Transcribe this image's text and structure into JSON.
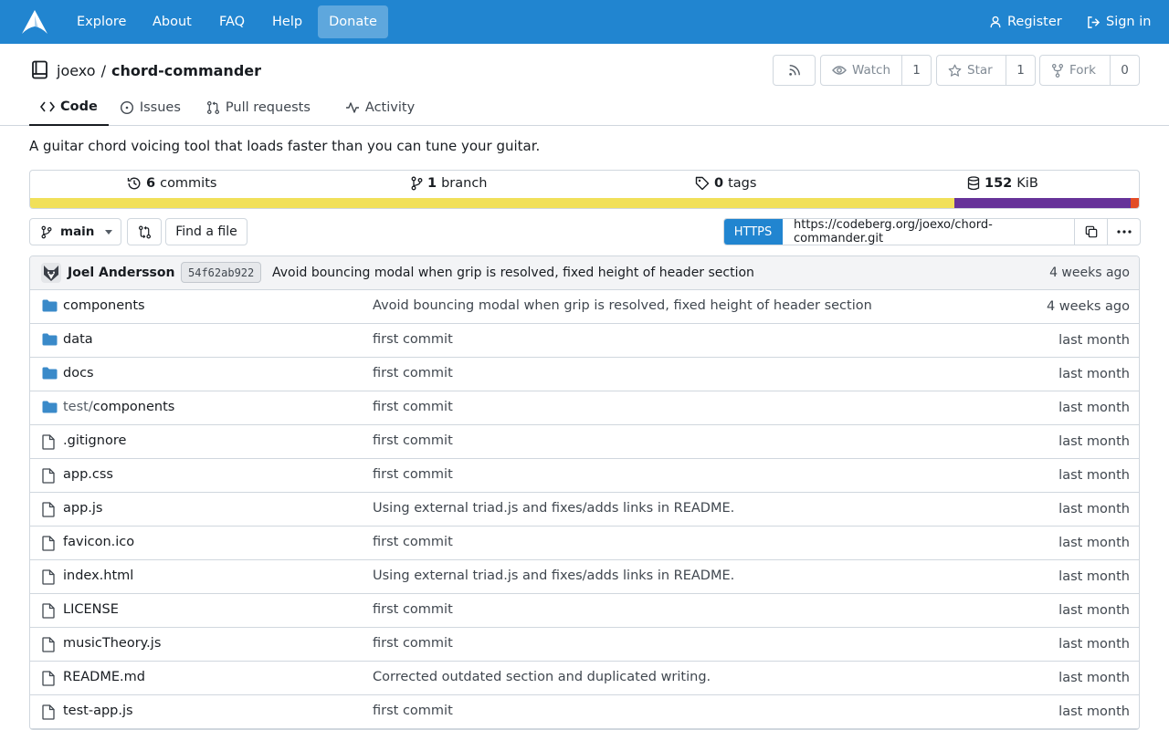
{
  "nav": {
    "items": [
      "Explore",
      "About",
      "FAQ",
      "Help"
    ],
    "donate": "Donate",
    "register": "Register",
    "sign_in": "Sign in",
    "color": "#2185d0"
  },
  "repo": {
    "owner": "joexo",
    "separator": "/",
    "name": "chord-commander",
    "watch_label": "Watch",
    "watch_count": "1",
    "star_label": "Star",
    "star_count": "1",
    "fork_label": "Fork",
    "fork_count": "0"
  },
  "tabs": [
    {
      "label": "Code",
      "icon": "code-icon",
      "active": true
    },
    {
      "label": "Issues",
      "icon": "issue-icon"
    },
    {
      "label": "Pull requests",
      "icon": "pull-request-icon"
    },
    {
      "label": "Activity",
      "icon": "pulse-icon"
    }
  ],
  "description": "A guitar chord voicing tool that loads faster than you can tune your guitar.",
  "stats": {
    "commits_num": "6",
    "commits_label": "commits",
    "branches_num": "1",
    "branches_label": "branch",
    "tags_num": "0",
    "tags_label": "tags",
    "size_num": "152",
    "size_label": "KiB"
  },
  "languages": [
    {
      "color": "#f1e05a",
      "percent": 83.4
    },
    {
      "color": "#663399",
      "percent": 15.9
    },
    {
      "color": "#e34c26",
      "percent": 0.7
    }
  ],
  "toolbar": {
    "branch": "main",
    "find_file": "Find a file",
    "protocol": "HTTPS",
    "clone_url": "https://codeberg.org/joexo/chord-commander.git"
  },
  "latest_commit": {
    "author": "Joel Andersson",
    "sha": "54f62ab922",
    "message": "Avoid bouncing modal when grip is resolved, fixed height of header section",
    "time": "4 weeks ago"
  },
  "files": [
    {
      "type": "folder",
      "name": "components",
      "message": "Avoid bouncing modal when grip is resolved, fixed height of header section",
      "time": "4 weeks ago"
    },
    {
      "type": "folder",
      "name": "data",
      "message": "first commit",
      "time": "last month"
    },
    {
      "type": "folder",
      "name": "docs",
      "message": "first commit",
      "time": "last month"
    },
    {
      "type": "folder",
      "name_prefix": "test/",
      "name": "components",
      "message": "first commit",
      "time": "last month"
    },
    {
      "type": "file",
      "name": ".gitignore",
      "message": "first commit",
      "time": "last month"
    },
    {
      "type": "file",
      "name": "app.css",
      "message": "first commit",
      "time": "last month"
    },
    {
      "type": "file",
      "name": "app.js",
      "message": "Using external triad.js and fixes/adds links in README.",
      "time": "last month"
    },
    {
      "type": "file",
      "name": "favicon.ico",
      "message": "first commit",
      "time": "last month"
    },
    {
      "type": "file",
      "name": "index.html",
      "message": "Using external triad.js and fixes/adds links in README.",
      "time": "last month"
    },
    {
      "type": "file",
      "name": "LICENSE",
      "message": "first commit",
      "time": "last month"
    },
    {
      "type": "file",
      "name": "musicTheory.js",
      "message": "first commit",
      "time": "last month"
    },
    {
      "type": "file",
      "name": "README.md",
      "message": "Corrected outdated section and duplicated writing.",
      "time": "last month"
    },
    {
      "type": "file",
      "name": "test-app.js",
      "message": "first commit",
      "time": "last month"
    }
  ]
}
